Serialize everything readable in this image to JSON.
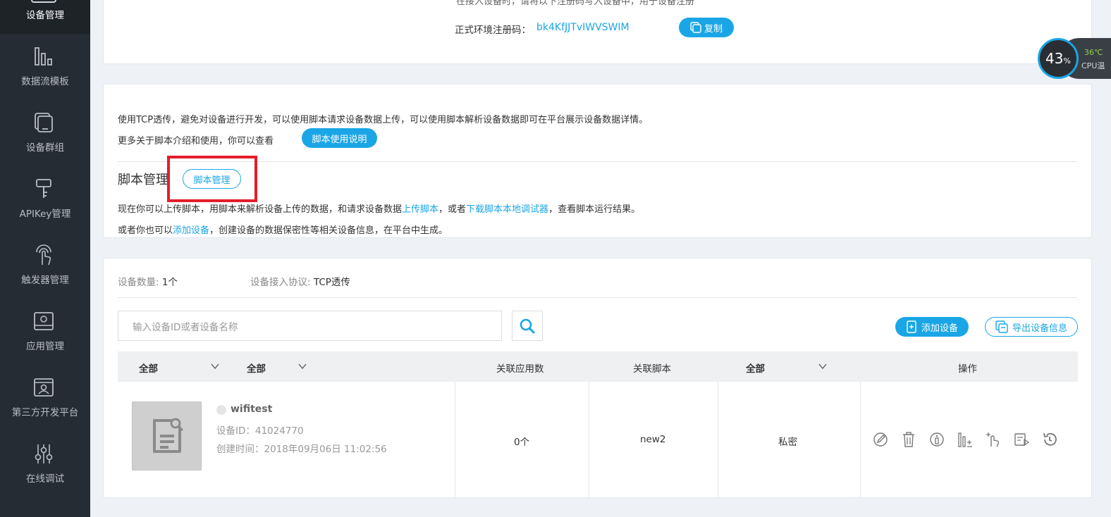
{
  "sidebar": {
    "active": {
      "label": "设备管理"
    },
    "items": [
      {
        "label": "数据流模板",
        "icon": "bar-chart-icon"
      },
      {
        "label": "设备群组",
        "icon": "device-group-icon"
      },
      {
        "label": "APIKey管理",
        "icon": "key-icon"
      },
      {
        "label": "触发器管理",
        "icon": "trigger-icon"
      },
      {
        "label": "应用管理",
        "icon": "app-icon"
      },
      {
        "label": "第三方开发平台",
        "icon": "third-party-icon"
      },
      {
        "label": "在线调试",
        "icon": "sliders-icon"
      }
    ]
  },
  "register": {
    "clipped_text": "在接入设备时，请将以下注册码写入设备中，用于设备注册",
    "label": "正式环境注册码：",
    "code": "bk4KfJJTvIWVSWIM",
    "copy_label": "复制"
  },
  "script": {
    "intro": "使用TCP透传，避免对设备进行开发，可以使用脚本请求设备数据上传，可以使用脚本解析设备数据即可在平台展示设备数据详情。",
    "more": "更多关于脚本介绍和使用，你可以查看",
    "doc_button": "脚本使用说明",
    "title": "脚本管理",
    "manage_button": "脚本管理",
    "line1_a": "现在你可以上传脚本，用脚本来解析设备上传的数据，和请求设备数据",
    "line1_link1": "上传脚本",
    "line1_b": "，或者",
    "line1_link2": "下载脚本本地调试器",
    "line1_c": "，查看脚本运行结果。",
    "line2_a": "或者你也可以",
    "line2_link": "添加设备",
    "line2_b": "，创建设备的数据保密性等相关设备信息，在平台中生成。"
  },
  "devices": {
    "count_label": "设备数量:",
    "count_value": "1个",
    "protocol_label": "设备接入协议:",
    "protocol_value": "TCP透传",
    "search_placeholder": "输入设备ID或者设备名称",
    "add_button": "添加设备",
    "export_button": "导出设备信息",
    "columns": {
      "filter1": "全部",
      "filter2": "全部",
      "apps": "关联应用数",
      "script": "关联脚本",
      "filter3": "全部",
      "actions": "操作"
    },
    "rows": [
      {
        "name": "wifitest",
        "id_line": "设备ID：41024770",
        "created_line": "创建时间：2018年09月06日 11:02:56",
        "apps": "0个",
        "script": "new2",
        "privacy": "私密"
      }
    ]
  },
  "cpu": {
    "percent": "43",
    "percent_unit": "%",
    "temp": "36℃",
    "label": "CPU温"
  },
  "colors": {
    "accent": "#1aa6e6",
    "sidebar": "#262c33",
    "highlight": "#e41e2b"
  }
}
